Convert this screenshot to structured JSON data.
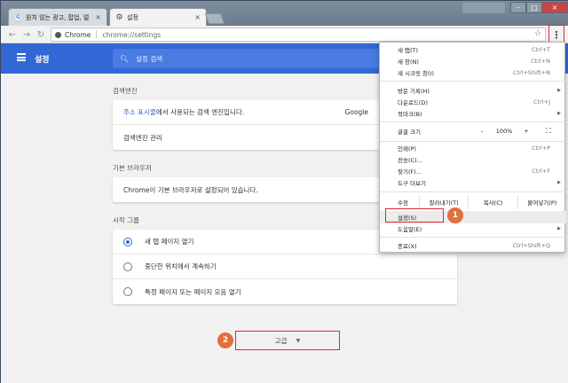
{
  "tabs": [
    {
      "title": "원치 않는 광고, 팝업, 멀",
      "icon": "google-icon"
    },
    {
      "title": "설정",
      "icon": "gear-icon"
    }
  ],
  "toolbar": {
    "secure_label": "Chrome",
    "url": "chrome://settings"
  },
  "appbar": {
    "title": "설정",
    "search_placeholder": "설정 검색"
  },
  "search_engine": {
    "heading": "검색엔진",
    "row1_link": "주소 표시줄",
    "row1_text": "에서 사용되는 검색 엔진입니다.",
    "row1_value": "Google",
    "row2": "검색엔진 관리"
  },
  "default_browser": {
    "heading": "기본 브라우저",
    "text": "Chrome이 기본 브라우저로 설정되어 있습니다."
  },
  "startup": {
    "heading": "시작 그룹",
    "options": [
      {
        "label": "새 탭 페이지 열기",
        "checked": true
      },
      {
        "label": "중단한 위치에서 계속하기",
        "checked": false
      },
      {
        "label": "특정 페이지 또는 페이지 모음 열기",
        "checked": false
      }
    ]
  },
  "advanced_label": "고급",
  "menu": {
    "items_top": [
      {
        "label": "새 탭(T)",
        "shortcut": "Ctrl+T"
      },
      {
        "label": "새 창(N)",
        "shortcut": "Ctrl+N"
      },
      {
        "label": "새 시크릿 창(I)",
        "shortcut": "Ctrl+Shift+N"
      }
    ],
    "items_mid": [
      {
        "label": "방문 기록(H)",
        "shortcut": "",
        "submenu": true
      },
      {
        "label": "다운로드(D)",
        "shortcut": "Ctrl+J",
        "submenu": false
      },
      {
        "label": "북마크(B)",
        "shortcut": "",
        "submenu": true
      }
    ],
    "zoom_label": "글꼴 크기",
    "zoom_minus": "-",
    "zoom_value": "100%",
    "zoom_plus": "+",
    "items_tools": [
      {
        "label": "인쇄(P)",
        "shortcut": "Ctrl+P",
        "submenu": false
      },
      {
        "label": "전송(C)...",
        "shortcut": "",
        "submenu": false
      },
      {
        "label": "찾기(F)...",
        "shortcut": "Ctrl+F",
        "submenu": false
      },
      {
        "label": "도구 더보기",
        "shortcut": "",
        "submenu": true
      }
    ],
    "edit_label": "수정",
    "cut": "잘라내기(T)",
    "copy": "복사(C)",
    "paste": "붙여넣기(P)",
    "settings": "설정(S)",
    "help": "도움말(E)",
    "exit": "종료(X)",
    "exit_shortcut": "Ctrl+Shift+Q"
  },
  "badges": {
    "one": "1",
    "two": "2"
  }
}
